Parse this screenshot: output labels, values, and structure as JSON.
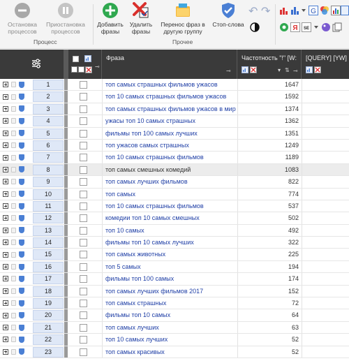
{
  "ribbon": {
    "stop_process": "Остановка процессов",
    "pause_process": "Приостановка процессов",
    "add_phrases": "Добавить фразы",
    "delete_phrases": "Удалить фразы",
    "move_phrases": "Перенос фраз в другую группу",
    "stop_words": "Стоп-слова",
    "group_process": "Процесс",
    "group_other": "Прочее",
    "colors": {
      "stop_icon": "#9c9c9c",
      "add_icon": "#2fa84f",
      "delete_icon": "#d9302c",
      "folder_icon": "#f4b63a",
      "shield_icon": "#4a7fd4"
    }
  },
  "header": {
    "phrase": "Фраза",
    "frequency": "Частотность \"!\" [W:",
    "query": "[QUERY] [YW]"
  },
  "rows": [
    {
      "num": "1",
      "phrase": "топ самых страшных фильмов ужасов",
      "freq": "1647"
    },
    {
      "num": "2",
      "phrase": "топ 10 самых страшных фильмов ужасов",
      "freq": "1592"
    },
    {
      "num": "3",
      "phrase": "топ самых страшных фильмов ужасов в мир",
      "freq": "1374"
    },
    {
      "num": "4",
      "phrase": "ужасы топ 10 самых страшных",
      "freq": "1362"
    },
    {
      "num": "5",
      "phrase": "фильмы топ 100 самых лучших",
      "freq": "1351"
    },
    {
      "num": "6",
      "phrase": "топ ужасов самых страшных",
      "freq": "1249"
    },
    {
      "num": "7",
      "phrase": "топ 10 самых страшных фильмов",
      "freq": "1189"
    },
    {
      "num": "8",
      "phrase": "топ самых смешных комедий",
      "freq": "1083"
    },
    {
      "num": "9",
      "phrase": "топ самых лучших фильмов",
      "freq": "822"
    },
    {
      "num": "10",
      "phrase": "топ самых",
      "freq": "774"
    },
    {
      "num": "11",
      "phrase": "топ 10 самых страшных фильмов",
      "freq": "537"
    },
    {
      "num": "12",
      "phrase": "комедии топ 10 самых смешных",
      "freq": "502"
    },
    {
      "num": "13",
      "phrase": "топ 10 самых",
      "freq": "492"
    },
    {
      "num": "14",
      "phrase": "фильмы топ 10 самых лучших",
      "freq": "322"
    },
    {
      "num": "15",
      "phrase": "топ самых животных",
      "freq": "225"
    },
    {
      "num": "16",
      "phrase": "топ 5 самых",
      "freq": "194"
    },
    {
      "num": "17",
      "phrase": "фильмы топ 100 самых",
      "freq": "174"
    },
    {
      "num": "18",
      "phrase": "топ самых лучших фильмов 2017",
      "freq": "152"
    },
    {
      "num": "19",
      "phrase": "топ самых страшных",
      "freq": "72"
    },
    {
      "num": "20",
      "phrase": "фильмы топ 10 самых",
      "freq": "64"
    },
    {
      "num": "21",
      "phrase": "топ самых лучших",
      "freq": "63"
    },
    {
      "num": "22",
      "phrase": "топ 10 самых лучших",
      "freq": "52"
    },
    {
      "num": "23",
      "phrase": "топ самых красивых",
      "freq": "52"
    }
  ]
}
